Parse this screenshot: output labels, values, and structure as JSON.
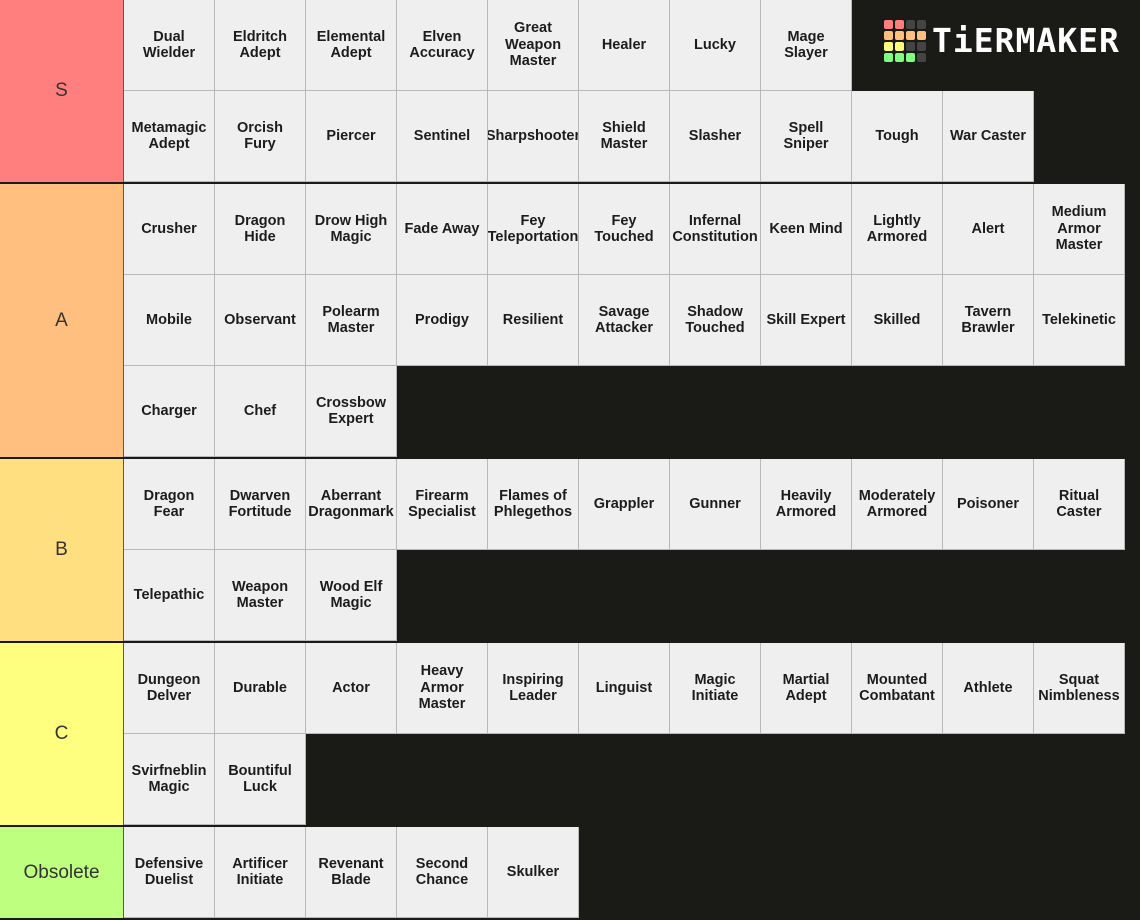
{
  "logo": {
    "text": "TiERMAKER",
    "grid_colors": [
      "#ff7f7f",
      "#ff7f7f",
      "#444444",
      "#444444",
      "#ffbf7f",
      "#ffbf7f",
      "#ffbf7f",
      "#ffbf7f",
      "#ffff7f",
      "#ffff7f",
      "#444444",
      "#444444",
      "#7fff7f",
      "#7fff7f",
      "#7fff7f",
      "#444444"
    ]
  },
  "tiers": [
    {
      "label": "S",
      "color": "#ff7f7f",
      "items": [
        [
          "Dual",
          "Wielder"
        ],
        [
          "Eldritch",
          "Adept"
        ],
        [
          "Elemental",
          "Adept"
        ],
        [
          "Elven",
          "Accuracy"
        ],
        [
          "Great",
          "Weapon",
          "Master"
        ],
        [
          "Healer"
        ],
        [
          "Lucky"
        ],
        [
          "Mage",
          "Slayer"
        ],
        [
          "Metamagic",
          "Adept"
        ],
        [
          "Orcish",
          "Fury"
        ],
        [
          "Piercer"
        ],
        [
          "Sentinel"
        ],
        [
          "Sharpshooter"
        ],
        [
          "Shield",
          "Master"
        ],
        [
          "Slasher"
        ],
        [
          "Spell",
          "Sniper"
        ],
        [
          "Tough"
        ],
        [
          "War Caster"
        ]
      ]
    },
    {
      "label": "A",
      "color": "#ffbf7f",
      "items": [
        [
          "Crusher"
        ],
        [
          "Dragon",
          "Hide"
        ],
        [
          "Drow High",
          "Magic"
        ],
        [
          "Fade Away"
        ],
        [
          "Fey",
          "Teleportation"
        ],
        [
          "Fey",
          "Touched"
        ],
        [
          "Infernal",
          "Constitution"
        ],
        [
          "Keen Mind"
        ],
        [
          "Lightly",
          "Armored"
        ],
        [
          "Alert"
        ],
        [
          "Medium",
          "Armor",
          "Master"
        ],
        [
          "Mobile"
        ],
        [
          "Observant"
        ],
        [
          "Polearm",
          "Master"
        ],
        [
          "Prodigy"
        ],
        [
          "Resilient"
        ],
        [
          "Savage",
          "Attacker"
        ],
        [
          "Shadow",
          "Touched"
        ],
        [
          "Skill Expert"
        ],
        [
          "Skilled"
        ],
        [
          "Tavern",
          "Brawler"
        ],
        [
          "Telekinetic"
        ],
        [
          "Charger"
        ],
        [
          "Chef"
        ],
        [
          "Crossbow",
          "Expert"
        ]
      ]
    },
    {
      "label": "B",
      "color": "#ffdf7f",
      "items": [
        [
          "Dragon",
          "Fear"
        ],
        [
          "Dwarven",
          "Fortitude"
        ],
        [
          "Aberrant",
          "Dragonmark"
        ],
        [
          "Firearm",
          "Specialist"
        ],
        [
          "Flames of",
          "Phlegethos"
        ],
        [
          "Grappler"
        ],
        [
          "Gunner"
        ],
        [
          "Heavily",
          "Armored"
        ],
        [
          "Moderately",
          "Armored"
        ],
        [
          "Poisoner"
        ],
        [
          "Ritual",
          "Caster"
        ],
        [
          "Telepathic"
        ],
        [
          "Weapon",
          "Master"
        ],
        [
          "Wood Elf",
          "Magic"
        ]
      ]
    },
    {
      "label": "C",
      "color": "#ffff7f",
      "items": [
        [
          "Dungeon",
          "Delver"
        ],
        [
          "Durable"
        ],
        [
          "Actor"
        ],
        [
          "Heavy",
          "Armor",
          "Master"
        ],
        [
          "Inspiring",
          "Leader"
        ],
        [
          "Linguist"
        ],
        [
          "Magic",
          "Initiate"
        ],
        [
          "Martial",
          "Adept"
        ],
        [
          "Mounted",
          "Combatant"
        ],
        [
          "Athlete"
        ],
        [
          "Squat",
          "Nimbleness"
        ],
        [
          "Svirfneblin",
          "Magic"
        ],
        [
          "Bountiful",
          "Luck"
        ]
      ]
    },
    {
      "label": "Obsolete",
      "color": "#bfff7f",
      "items": [
        [
          "Defensive",
          "Duelist"
        ],
        [
          "Artificer",
          "Initiate"
        ],
        [
          "Revenant",
          "Blade"
        ],
        [
          "Second",
          "Chance"
        ],
        [
          "Skulker"
        ]
      ]
    }
  ]
}
